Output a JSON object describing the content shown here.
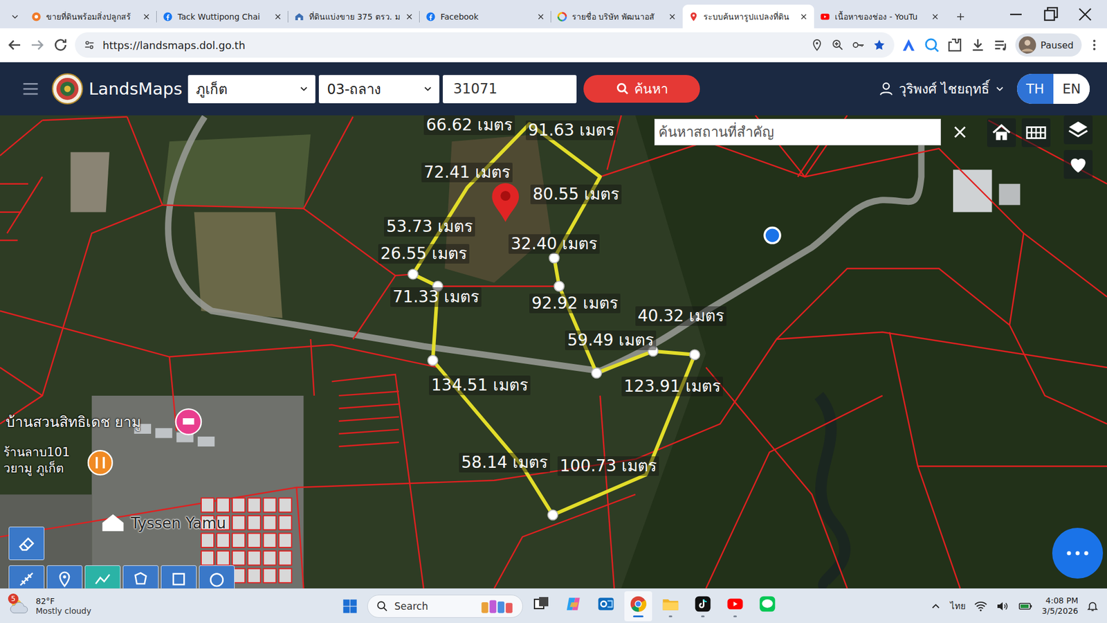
{
  "browser": {
    "tabs": [
      {
        "label": "ขายที่ดินพร้อมสิ่งปลูกสร้",
        "kind": "tracker",
        "selected": false
      },
      {
        "label": "Tack Wuttipong Chai",
        "kind": "facebook",
        "selected": false
      },
      {
        "label": "ที่ดินแบ่งขาย 375 ตรว. ม",
        "kind": "dol",
        "selected": false
      },
      {
        "label": "Facebook",
        "kind": "facebook",
        "selected": false
      },
      {
        "label": "รายชื่อ บริษัท พัฒนาอสั",
        "kind": "google",
        "selected": false
      },
      {
        "label": "ระบบค้นหารูปแปลงที่ดิน",
        "kind": "pin",
        "selected": true
      },
      {
        "label": "เนื้อหาของช่อง - YouTu",
        "kind": "youtube",
        "selected": false
      }
    ],
    "address": {
      "url": "https://landsmaps.dol.go.th"
    },
    "profile": {
      "label": "Paused"
    }
  },
  "header": {
    "brand": "LandsMaps",
    "province": "ภูเก็ต",
    "district": "03-ถลาง",
    "parcel": "31071",
    "search_button": "ค้นหา",
    "user": "วุริพงศ์ ไชยฤทธิ์",
    "languages": [
      {
        "label": "TH",
        "selected": true
      },
      {
        "label": "EN",
        "selected": false
      }
    ]
  },
  "map": {
    "place_search": {
      "placeholder": "ค้นหาสถานที่สำคัญ"
    },
    "measurements": [
      "66.62 เมตร",
      "91.63 เมตร",
      "72.41 เมตร",
      "80.55 เมตร",
      "53.73 เมตร",
      "26.55 เมตร",
      "32.40 เมตร",
      "71.33 เมตร",
      "92.92 เมตร",
      "59.49 เมตร",
      "40.32 เมตร",
      "134.51 เมตร",
      "123.91 เมตร",
      "58.14 เมตร",
      "100.73 เมตร"
    ],
    "places": [
      "บ้านสวนสิทธิเดช ยามู",
      "ร้านลาบ101",
      "วยามู ภูเก็ต",
      "Tyssen Yamu"
    ]
  },
  "taskbar": {
    "weather": {
      "badge": "5",
      "temperature": "82°F",
      "condition": "Mostly cloudy"
    },
    "search": {
      "label": "Search"
    },
    "apps": [
      {
        "kind": "taskview",
        "running": false,
        "selected": false
      },
      {
        "kind": "copilot",
        "running": false,
        "selected": false
      },
      {
        "kind": "outlook",
        "running": false,
        "selected": false
      },
      {
        "kind": "chrome",
        "running": true,
        "selected": true
      },
      {
        "kind": "explorer",
        "running": true,
        "selected": false
      },
      {
        "kind": "tiktok",
        "running": true,
        "selected": false
      },
      {
        "kind": "youtube",
        "running": true,
        "selected": false
      },
      {
        "kind": "line",
        "running": false,
        "selected": false
      }
    ],
    "input_language": "ไทย",
    "time": "4:08 PM",
    "date": "3/5/2026"
  }
}
